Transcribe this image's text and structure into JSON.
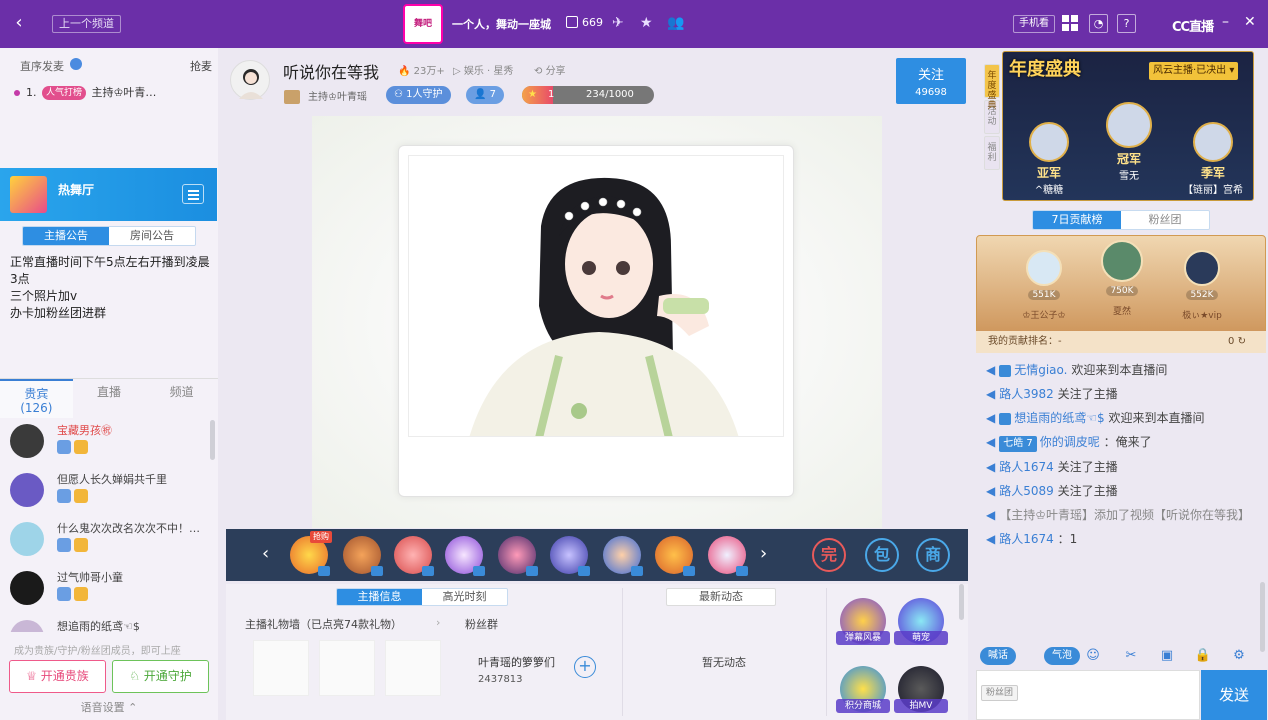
{
  "topbar": {
    "prev_channel": "上一个频道",
    "logo_text": "舞吧",
    "channel_name": "一个人，舞动一座城",
    "online_count": "669",
    "mobile_watch": "手机看",
    "brand": "CC直播",
    "icons": [
      "back-icon",
      "plane-icon",
      "star-icon",
      "users-icon",
      "grid-icon",
      "bell-icon",
      "help-icon",
      "minimize-icon",
      "restore-icon",
      "close-icon"
    ]
  },
  "left": {
    "seq_header": "直序发麦",
    "grab": "抢麦",
    "rank_item": {
      "index": "1.",
      "badge": "人气打榜",
      "name": "主持♔叶青…"
    },
    "hall_name": "热舞厅",
    "tabs": [
      "主播公告",
      "房间公告"
    ],
    "notice": [
      "正常直播时间下午5点左右开播到凌晨3点",
      "三个照片加v",
      "办卡加粉丝团进群"
    ],
    "guest_tabs": [
      {
        "label": "贵宾",
        "count": "(126)"
      },
      {
        "label": "直播",
        "count": ""
      },
      {
        "label": "频道",
        "count": ""
      }
    ],
    "guests": [
      {
        "name": "宝藏男孩㊗",
        "color": "#e04a4a",
        "av": "#3a3a3a"
      },
      {
        "name": "但愿人长久婵娟共千里",
        "color": "#444",
        "av": "#6a5ac4"
      },
      {
        "name": "什么鬼次次改名次次不中！…",
        "color": "#444",
        "av": "#9ed4e8"
      },
      {
        "name": "过气帅哥小童",
        "color": "#444",
        "av": "#1a1a1a"
      },
      {
        "name": "想追雨的纸鸢☜$",
        "color": "#444",
        "av": "#c9b7d6"
      }
    ],
    "join_hint": "成为贵族/守护/粉丝团成员，即可上座",
    "btn_noble": "开通贵族",
    "btn_guard": "开通守护",
    "voice_settings": "语音设置"
  },
  "center": {
    "title": "听说你在等我",
    "heat": "23万+",
    "category": "娱乐 · 星秀",
    "share": "分享",
    "anchor": "主持♔叶青瑶",
    "guard_pill": "1人守护",
    "fans_pill": "7",
    "level": "1",
    "level_progress": "234/1000",
    "level_fraction": 0.234,
    "follow": "关注",
    "follow_count": "49698",
    "info_tabs": [
      "主播信息",
      "高光时刻"
    ],
    "gift_wall": "主播礼物墙（已点亮74款礼物）",
    "fan_group_label": "粉丝群",
    "fan_group_name": "叶青瑶的箩箩们",
    "fan_group_number": "2437813",
    "news_tab": "最新动态",
    "no_news": "暂无动态",
    "features": [
      "弹幕风暴",
      "萌宠",
      "积分商城",
      "拍MV"
    ],
    "gift_hot_tag": "抢购",
    "gift_badges": [
      "完",
      "包",
      "商"
    ],
    "colors": {
      "accent": "#2e8ee2",
      "topbar": "#6b2fa8"
    }
  },
  "right": {
    "side_tabs": [
      "年度盛典",
      "活动",
      "福利"
    ],
    "gala_title": "年度盛典",
    "gala_result": "风云主播·已决出",
    "winners": [
      {
        "rank": "亚军",
        "name": "^糖糖"
      },
      {
        "rank": "冠军",
        "name": "雪无"
      },
      {
        "rank": "季军",
        "name": "【链丽】宫希"
      }
    ],
    "rank_tabs": [
      "7日贡献榜",
      "粉丝团"
    ],
    "podium": [
      {
        "amount": "551K",
        "name": "♔王公子♔"
      },
      {
        "amount": "750K",
        "name": "夏然"
      },
      {
        "amount": "552K",
        "name": "极ぃ★vip"
      }
    ],
    "my_rank_label": "我的贡献排名：-",
    "my_rank_value": "0",
    "chat": [
      {
        "user": "无情giao.",
        "text": "欢迎来到本直播间",
        "type": "welcome"
      },
      {
        "user": "路人3982",
        "text": "关注了主播",
        "type": "follow"
      },
      {
        "user": "想追雨的纸鸢☜$",
        "text": "欢迎来到本直播间",
        "type": "welcome"
      },
      {
        "user": "你的调皮呢",
        "text": "：俺来了",
        "type": "say",
        "lvl": "七皓 7"
      },
      {
        "user": "路人1674",
        "text": "关注了主播",
        "type": "follow"
      },
      {
        "user": "路人5089",
        "text": "关注了主播",
        "type": "follow"
      },
      {
        "user": "",
        "text": "【主持♔叶青瑶】添加了视频【听说你在等我】",
        "type": "sys"
      },
      {
        "user": "路人1674",
        "text": "：1",
        "type": "say"
      }
    ],
    "chat_tools": [
      "喊话",
      "气泡"
    ],
    "fan_label": "粉丝团",
    "input_placeholder": "",
    "send": "发送"
  }
}
